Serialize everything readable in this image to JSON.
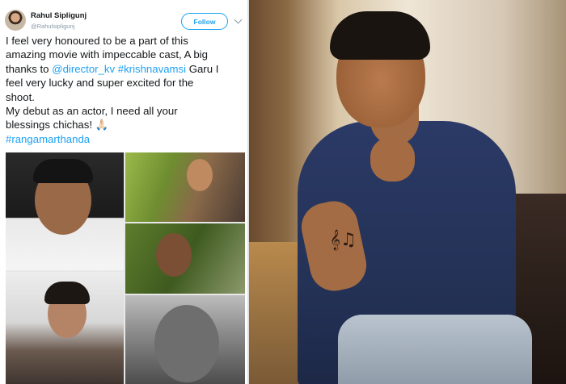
{
  "tweet": {
    "author": {
      "display_name": "Rahul Sipligunj",
      "handle": "@Rahulsipligunj"
    },
    "follow_label": "Follow",
    "body_lines": [
      [
        {
          "text": "I feel very honoured to be a part of this",
          "link": false
        }
      ],
      [
        {
          "text": "amazing movie with impeccable cast, A big",
          "link": false
        }
      ],
      [
        {
          "text": "thanks to ",
          "link": false
        },
        {
          "text": "@director_kv",
          "link": true
        },
        {
          "text": " ",
          "link": false
        },
        {
          "text": "#krishnavamsi",
          "link": true
        },
        {
          "text": " Garu I",
          "link": false
        }
      ],
      [
        {
          "text": "feel very lucky and super excited for the",
          "link": false
        }
      ],
      [
        {
          "text": "shoot.",
          "link": false
        }
      ],
      [
        {
          "text": "My debut as an actor, I need all your",
          "link": false
        }
      ],
      [
        {
          "text": "blessings chichas! 🙏🏻",
          "link": false
        }
      ],
      [
        {
          "text": "#rangamarthanda",
          "link": true
        }
      ]
    ]
  },
  "colors": {
    "link": "#1da1f2",
    "text": "#14171a",
    "muted": "#8899a6"
  }
}
